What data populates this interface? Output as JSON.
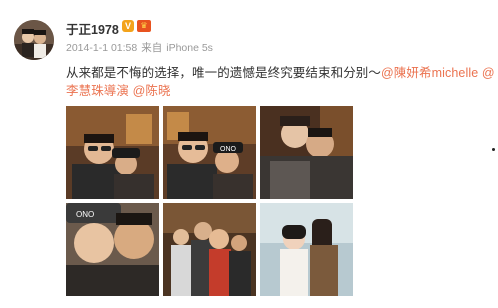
{
  "post": {
    "username": "于正1978",
    "verified_icon": "v-badge-icon",
    "vip_icon": "crown-icon",
    "time": "2014-1-1 01:58",
    "source_prefix": "来自",
    "source": "iPhone 5s",
    "text_main": "从来都是不悔的选择，唯一的遗憾是终究要结束和分别～",
    "mentions": [
      "@陳妍希michelle",
      "@李慧珠導演",
      "@陈晓"
    ],
    "photos": [
      "photo-1",
      "photo-2",
      "photo-3",
      "photo-4",
      "photo-5",
      "photo-6"
    ],
    "photo_text": {
      "cap1": "ONO",
      "cap2": "ONO"
    }
  },
  "colors": {
    "mention": "#eb7350",
    "text": "#333333",
    "meta": "#999999"
  }
}
